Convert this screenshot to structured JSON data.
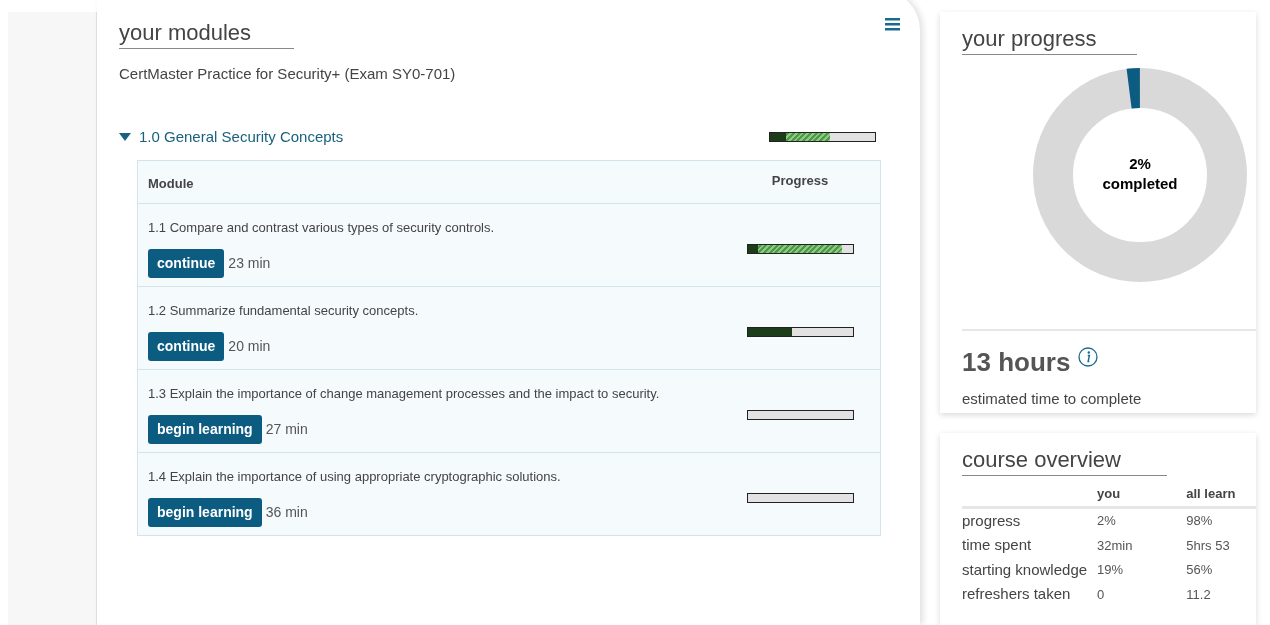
{
  "modules_panel": {
    "title": "your modules",
    "course_name": "CertMaster Practice for Security+ (Exam SY0-701)",
    "sections": [
      {
        "title": "1.0 General Security Concepts",
        "expanded": true,
        "segments": [
          {
            "kind": "learning",
            "level": 0.57
          },
          {
            "kind": "mastered",
            "level": 0.15
          }
        ],
        "table": {
          "columns": [
            "Module",
            "Progress"
          ],
          "rows": [
            {
              "text": "1.1 Compare and contrast various types of security controls.",
              "button": "continue",
              "duration": "23 min",
              "segments": [
                {
                  "kind": "learning",
                  "level": 0.9
                },
                {
                  "kind": "mastered",
                  "level": 0.1
                }
              ]
            },
            {
              "text": "1.2 Summarize fundamental security concepts.",
              "button": "continue",
              "duration": "20 min",
              "segments": [
                {
                  "kind": "mastered",
                  "level": 0.42
                }
              ]
            },
            {
              "text": "1.3 Explain the importance of change management processes and the impact to security.",
              "button": "begin learning",
              "duration": "27 min",
              "segments": []
            },
            {
              "text": "1.4 Explain the importance of using appropriate cryptographic solutions.",
              "button": "begin learning",
              "duration": "36 min",
              "segments": []
            }
          ]
        }
      }
    ]
  },
  "progress_card": {
    "title": "your progress",
    "level": 0.02,
    "percent": "2%",
    "percent_label": "completed",
    "hours": "13 hours",
    "hours_caption": "estimated time to complete"
  },
  "overview_card": {
    "title": "course overview",
    "columns": [
      "you",
      "all learn"
    ],
    "rows": [
      {
        "label": "progress",
        "values": [
          "2%",
          "98%"
        ]
      },
      {
        "label": "time spent",
        "values": [
          "32min",
          "5hrs 53"
        ]
      },
      {
        "label": "starting knowledge",
        "values": [
          "19%",
          "56%"
        ]
      },
      {
        "label": "refreshers taken",
        "values": [
          "0",
          "11.2"
        ]
      }
    ]
  }
}
